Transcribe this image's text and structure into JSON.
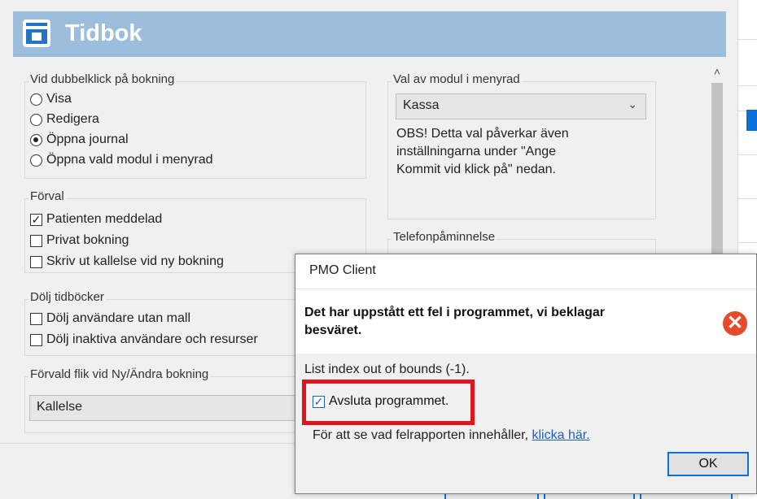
{
  "window": {
    "title": "Tidbok",
    "icon": "calendar-icon",
    "header_color": "#9dbddc"
  },
  "double_click_group": {
    "legend": "Vid dubbelklick på bokning",
    "options": [
      {
        "label": "Visa",
        "selected": false
      },
      {
        "label": "Redigera",
        "selected": false
      },
      {
        "label": "Öppna journal",
        "selected": true
      },
      {
        "label": "Öppna vald modul i menyrad",
        "selected": false
      }
    ]
  },
  "defaults_group": {
    "legend": "Förval",
    "options": [
      {
        "label": "Patienten meddelad",
        "checked": true
      },
      {
        "label": "Privat bokning",
        "checked": false
      },
      {
        "label": "Skriv ut kallelse vid ny bokning",
        "checked": false
      }
    ]
  },
  "hide_group": {
    "legend": "Dölj tidböcker",
    "options": [
      {
        "label": "Dölj användare utan mall",
        "checked": false
      },
      {
        "label": "Dölj inaktiva användare och resurser",
        "checked": false
      }
    ]
  },
  "default_tab_group": {
    "legend": "Förvald flik vid Ny/Ändra bokning",
    "value": "Kallelse"
  },
  "module_group": {
    "legend": "Val av modul i menyrad",
    "value": "Kassa",
    "note": "OBS! Detta val påverkar även inställningarna under \"Ange Kommit vid klick på\" nedan."
  },
  "phone_group": {
    "legend": "Telefonpåminnelse"
  },
  "dialog": {
    "title": "PMO Client",
    "message": "Det har uppstått ett fel i programmet, vi beklagar besväret.",
    "detail": "List index out of bounds (-1).",
    "exit_label": "Avsluta programmet.",
    "exit_checked": true,
    "report_prefix": "För att se vad felrapporten innehåller,",
    "report_link": "klicka här.",
    "ok_label": "OK",
    "error_icon": "error-x-icon",
    "highlight_color": "#e0141e"
  }
}
